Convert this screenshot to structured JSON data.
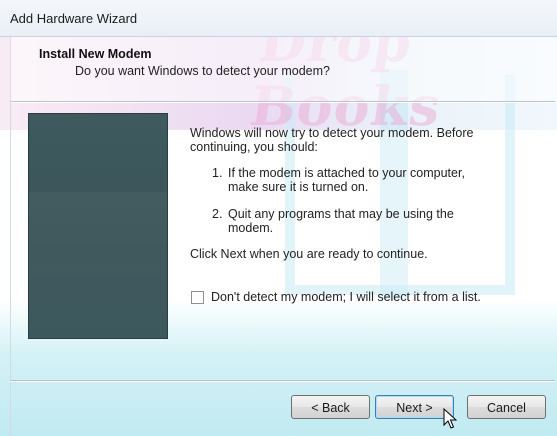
{
  "window": {
    "title": "Add Hardware Wizard"
  },
  "watermark": {
    "text": "Drop Books"
  },
  "header": {
    "title": "Install New Modem",
    "subtitle": "Do you want Windows to detect your modem?"
  },
  "content": {
    "intro": "Windows will now try to detect your modem.  Before continuing, you should:",
    "steps": [
      {
        "number": "1.",
        "text": "If the modem is attached to your computer, make sure it is turned on."
      },
      {
        "number": "2.",
        "text": "Quit any programs that may be using the modem."
      }
    ],
    "instruction": "Click Next when you are ready to continue.",
    "checkbox": {
      "label": "Don't detect my modem; I will select it from a list.",
      "checked": false
    }
  },
  "buttons": {
    "back": "< Back",
    "next": "Next >",
    "cancel": "Cancel"
  },
  "colors": {
    "side_image": "#3c575c",
    "button_default_border": "#3c7fb1"
  },
  "icons": {
    "cursor": "mouse-pointer-icon"
  }
}
